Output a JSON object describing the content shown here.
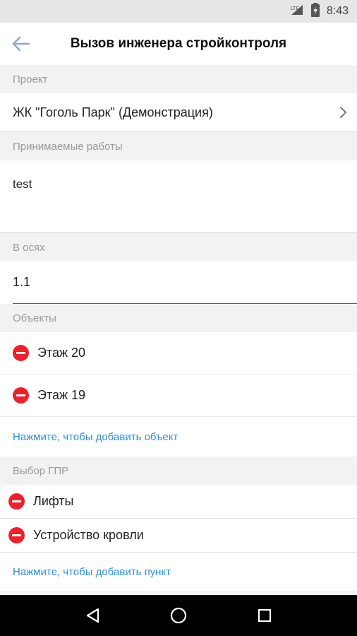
{
  "status_bar": {
    "time": "8:43"
  },
  "app_bar": {
    "title": "Вызов инженера стройконтроля"
  },
  "project": {
    "header": "Проект",
    "value": "ЖК \"Гоголь Парк\" (Демонстрация)"
  },
  "works": {
    "header": "Принимаемые работы",
    "value": "test"
  },
  "axes": {
    "header": "В осях",
    "value": "1.1"
  },
  "objects": {
    "header": "Объекты",
    "items": [
      {
        "label": "Этаж 20"
      },
      {
        "label": "Этаж 19"
      }
    ],
    "add_link": "Нажмите, чтобы добавить объект"
  },
  "gpr": {
    "header": "Выбор ГПР",
    "items": [
      {
        "label": "Лифты"
      },
      {
        "label": "Устройство кровли"
      }
    ],
    "add_link": "Нажмите, чтобы добавить пункт"
  },
  "colors": {
    "accent_link": "#2a8ee0",
    "remove_red": "#f0202a"
  }
}
